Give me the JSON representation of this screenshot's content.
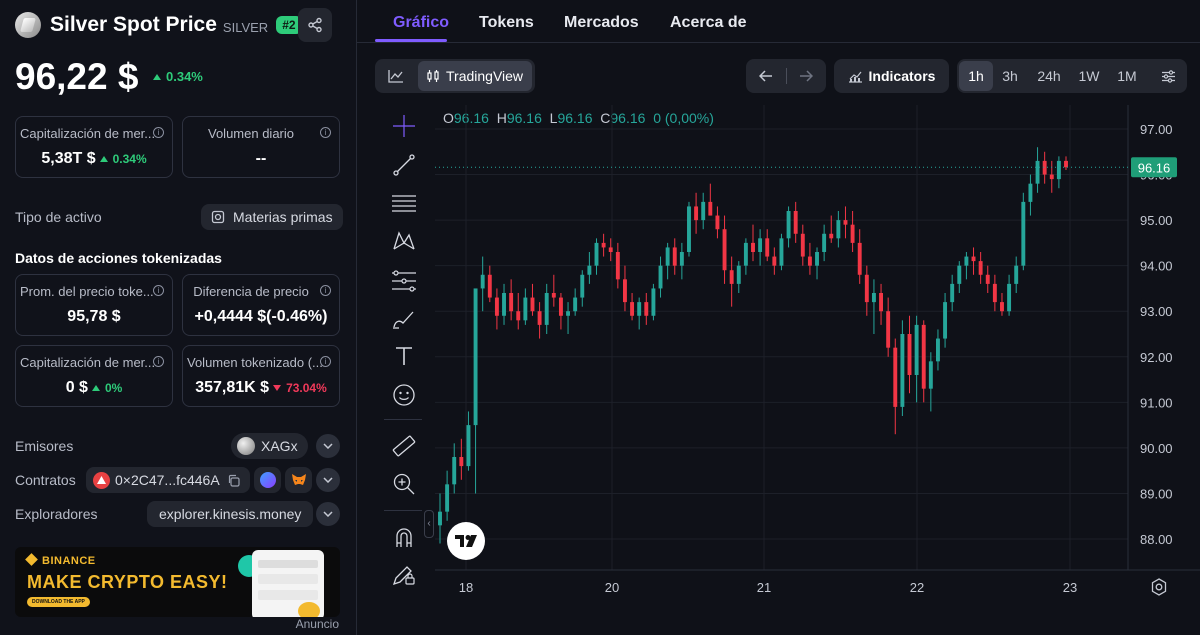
{
  "asset": {
    "name": "Silver Spot Price",
    "symbol": "SILVER",
    "rank": "#2",
    "price": "96,22 $",
    "change": "0.34%"
  },
  "stats": {
    "market_cap": {
      "label": "Capitalización de mer...",
      "value": "5,38T $",
      "change": "0.34%"
    },
    "daily_volume": {
      "label": "Volumen diario",
      "value": "--"
    }
  },
  "asset_type": {
    "label": "Tipo de activo",
    "value": "Materias primas"
  },
  "tokenized": {
    "title": "Datos de acciones tokenizadas",
    "avg_price": {
      "label": "Prom. del precio toke...",
      "value": "95,78 $"
    },
    "price_diff": {
      "label": "Diferencia de precio",
      "value": "+0,4444 $(-0.46%)"
    },
    "tok_market_cap": {
      "label": "Capitalización de mer...",
      "value": "0 $",
      "change": "0%"
    },
    "tok_volume": {
      "label": "Volumen tokenizado (...",
      "value": "357,81K $",
      "change": "73.04%"
    }
  },
  "issuers": {
    "label": "Emisores",
    "value": "XAGx"
  },
  "contracts": {
    "label": "Contratos",
    "value": "0×2C47...fc446A"
  },
  "explorers": {
    "label": "Exploradores",
    "value": "explorer.kinesis.money"
  },
  "banner": {
    "brand": "BINANCE",
    "headline": "MAKE CRYPTO EASY!",
    "cta": "DOWNLOAD THE APP",
    "ad_label": "Anuncio"
  },
  "tabs": [
    {
      "label": "Gráfico",
      "active": true
    },
    {
      "label": "Tokens"
    },
    {
      "label": "Mercados"
    },
    {
      "label": "Acerca de"
    }
  ],
  "toolbar": {
    "tradingview_label": "TradingView",
    "indicators_label": "Indicators",
    "timeframes": [
      "1h",
      "3h",
      "24h",
      "1W",
      "1M"
    ],
    "selected_timeframe": "1h"
  },
  "ohlc": {
    "o": "96.16",
    "h": "96.16",
    "l": "96.16",
    "c": "96.16",
    "chg": "0 (0,00%)"
  },
  "colors": {
    "up": "#26a69a",
    "down": "#f23645",
    "accent": "#7f5cff",
    "green": "#2ecb7a",
    "red": "#f0395a"
  },
  "chart_data": {
    "type": "candlestick",
    "title": "",
    "x_ticks": [
      "18",
      "20",
      "21",
      "22",
      "23"
    ],
    "y_ticks": [
      "97.00",
      "96.00",
      "95.00",
      "94.00",
      "93.00",
      "92.00",
      "91.00",
      "90.00",
      "89.00",
      "88.00"
    ],
    "ylim": [
      87.6,
      97.4
    ],
    "last_price": "96.16",
    "timeframe": "1h",
    "candles": [
      {
        "o": 88.3,
        "h": 89.0,
        "l": 87.9,
        "c": 88.6
      },
      {
        "o": 88.6,
        "h": 89.5,
        "l": 88.4,
        "c": 89.2
      },
      {
        "o": 89.2,
        "h": 90.1,
        "l": 89.0,
        "c": 89.8
      },
      {
        "o": 89.8,
        "h": 90.2,
        "l": 89.3,
        "c": 89.6
      },
      {
        "o": 89.6,
        "h": 90.8,
        "l": 89.5,
        "c": 90.5
      },
      {
        "o": 90.5,
        "h": 93.5,
        "l": 89.0,
        "c": 93.5
      },
      {
        "o": 93.5,
        "h": 94.2,
        "l": 93.0,
        "c": 93.8
      },
      {
        "o": 93.8,
        "h": 94.0,
        "l": 93.2,
        "c": 93.3
      },
      {
        "o": 93.3,
        "h": 93.5,
        "l": 92.6,
        "c": 92.9
      },
      {
        "o": 92.9,
        "h": 93.6,
        "l": 92.7,
        "c": 93.4
      },
      {
        "o": 93.4,
        "h": 93.7,
        "l": 92.8,
        "c": 93.0
      },
      {
        "o": 93.0,
        "h": 93.4,
        "l": 92.6,
        "c": 92.8
      },
      {
        "o": 92.8,
        "h": 93.5,
        "l": 92.7,
        "c": 93.3
      },
      {
        "o": 93.3,
        "h": 93.6,
        "l": 92.9,
        "c": 93.0
      },
      {
        "o": 93.0,
        "h": 93.2,
        "l": 92.4,
        "c": 92.7
      },
      {
        "o": 92.7,
        "h": 93.6,
        "l": 92.5,
        "c": 93.4
      },
      {
        "o": 93.4,
        "h": 93.8,
        "l": 93.1,
        "c": 93.3
      },
      {
        "o": 93.3,
        "h": 93.4,
        "l": 92.6,
        "c": 92.9
      },
      {
        "o": 92.9,
        "h": 93.2,
        "l": 92.5,
        "c": 93.0
      },
      {
        "o": 93.0,
        "h": 93.5,
        "l": 92.9,
        "c": 93.3
      },
      {
        "o": 93.3,
        "h": 93.9,
        "l": 93.1,
        "c": 93.8
      },
      {
        "o": 93.8,
        "h": 94.3,
        "l": 93.6,
        "c": 94.0
      },
      {
        "o": 94.0,
        "h": 94.6,
        "l": 93.8,
        "c": 94.5
      },
      {
        "o": 94.5,
        "h": 94.7,
        "l": 94.2,
        "c": 94.4
      },
      {
        "o": 94.4,
        "h": 94.6,
        "l": 94.1,
        "c": 94.3
      },
      {
        "o": 94.3,
        "h": 94.5,
        "l": 93.5,
        "c": 93.7
      },
      {
        "o": 93.7,
        "h": 94.0,
        "l": 93.0,
        "c": 93.2
      },
      {
        "o": 93.2,
        "h": 93.4,
        "l": 92.8,
        "c": 92.9
      },
      {
        "o": 92.9,
        "h": 93.3,
        "l": 92.6,
        "c": 93.2
      },
      {
        "o": 93.2,
        "h": 93.4,
        "l": 92.7,
        "c": 92.9
      },
      {
        "o": 92.9,
        "h": 93.6,
        "l": 92.8,
        "c": 93.5
      },
      {
        "o": 93.5,
        "h": 94.2,
        "l": 93.3,
        "c": 94.0
      },
      {
        "o": 94.0,
        "h": 94.5,
        "l": 93.7,
        "c": 94.4
      },
      {
        "o": 94.4,
        "h": 94.6,
        "l": 93.8,
        "c": 94.0
      },
      {
        "o": 94.0,
        "h": 94.5,
        "l": 93.7,
        "c": 94.3
      },
      {
        "o": 94.3,
        "h": 95.4,
        "l": 94.2,
        "c": 95.3
      },
      {
        "o": 95.3,
        "h": 95.6,
        "l": 94.7,
        "c": 95.0
      },
      {
        "o": 95.0,
        "h": 95.6,
        "l": 94.8,
        "c": 95.4
      },
      {
        "o": 95.4,
        "h": 95.8,
        "l": 95.1,
        "c": 95.1
      },
      {
        "o": 95.1,
        "h": 95.3,
        "l": 94.6,
        "c": 94.8
      },
      {
        "o": 94.8,
        "h": 95.1,
        "l": 93.6,
        "c": 93.9
      },
      {
        "o": 93.9,
        "h": 94.2,
        "l": 93.1,
        "c": 93.6
      },
      {
        "o": 93.6,
        "h": 94.1,
        "l": 93.4,
        "c": 94.0
      },
      {
        "o": 94.0,
        "h": 94.6,
        "l": 93.8,
        "c": 94.5
      },
      {
        "o": 94.5,
        "h": 94.9,
        "l": 94.1,
        "c": 94.3
      },
      {
        "o": 94.3,
        "h": 94.8,
        "l": 94.0,
        "c": 94.6
      },
      {
        "o": 94.6,
        "h": 94.8,
        "l": 94.1,
        "c": 94.2
      },
      {
        "o": 94.2,
        "h": 94.4,
        "l": 93.8,
        "c": 94.0
      },
      {
        "o": 94.0,
        "h": 94.7,
        "l": 93.9,
        "c": 94.6
      },
      {
        "o": 94.6,
        "h": 95.3,
        "l": 94.4,
        "c": 95.2
      },
      {
        "o": 95.2,
        "h": 95.4,
        "l": 94.5,
        "c": 94.7
      },
      {
        "o": 94.7,
        "h": 94.9,
        "l": 94.0,
        "c": 94.2
      },
      {
        "o": 94.2,
        "h": 94.5,
        "l": 93.8,
        "c": 94.0
      },
      {
        "o": 94.0,
        "h": 94.4,
        "l": 93.7,
        "c": 94.3
      },
      {
        "o": 94.3,
        "h": 94.9,
        "l": 94.1,
        "c": 94.7
      },
      {
        "o": 94.7,
        "h": 95.1,
        "l": 94.5,
        "c": 94.6
      },
      {
        "o": 94.6,
        "h": 95.2,
        "l": 94.4,
        "c": 95.0
      },
      {
        "o": 95.0,
        "h": 95.3,
        "l": 94.6,
        "c": 94.9
      },
      {
        "o": 94.9,
        "h": 95.2,
        "l": 94.3,
        "c": 94.5
      },
      {
        "o": 94.5,
        "h": 94.8,
        "l": 93.6,
        "c": 93.8
      },
      {
        "o": 93.8,
        "h": 94.0,
        "l": 92.9,
        "c": 93.2
      },
      {
        "o": 93.2,
        "h": 93.7,
        "l": 92.5,
        "c": 93.4
      },
      {
        "o": 93.4,
        "h": 93.6,
        "l": 92.7,
        "c": 93.0
      },
      {
        "o": 93.0,
        "h": 93.3,
        "l": 92.0,
        "c": 92.2
      },
      {
        "o": 92.2,
        "h": 92.4,
        "l": 90.3,
        "c": 90.9
      },
      {
        "o": 90.9,
        "h": 92.8,
        "l": 90.7,
        "c": 92.5
      },
      {
        "o": 92.5,
        "h": 92.9,
        "l": 91.2,
        "c": 91.6
      },
      {
        "o": 91.6,
        "h": 92.9,
        "l": 91.0,
        "c": 92.7
      },
      {
        "o": 92.7,
        "h": 92.8,
        "l": 91.0,
        "c": 91.3
      },
      {
        "o": 91.3,
        "h": 92.1,
        "l": 90.8,
        "c": 91.9
      },
      {
        "o": 91.9,
        "h": 92.6,
        "l": 91.7,
        "c": 92.4
      },
      {
        "o": 92.4,
        "h": 93.4,
        "l": 92.2,
        "c": 93.2
      },
      {
        "o": 93.2,
        "h": 93.8,
        "l": 93.0,
        "c": 93.6
      },
      {
        "o": 93.6,
        "h": 94.1,
        "l": 93.4,
        "c": 94.0
      },
      {
        "o": 94.0,
        "h": 94.3,
        "l": 93.7,
        "c": 94.2
      },
      {
        "o": 94.2,
        "h": 94.4,
        "l": 93.8,
        "c": 94.1
      },
      {
        "o": 94.1,
        "h": 94.3,
        "l": 93.6,
        "c": 93.8
      },
      {
        "o": 93.8,
        "h": 94.0,
        "l": 93.4,
        "c": 93.6
      },
      {
        "o": 93.6,
        "h": 93.8,
        "l": 93.0,
        "c": 93.2
      },
      {
        "o": 93.2,
        "h": 93.4,
        "l": 92.9,
        "c": 93.0
      },
      {
        "o": 93.0,
        "h": 93.8,
        "l": 92.9,
        "c": 93.6
      },
      {
        "o": 93.6,
        "h": 94.2,
        "l": 93.4,
        "c": 94.0
      },
      {
        "o": 94.0,
        "h": 95.6,
        "l": 93.9,
        "c": 95.4
      },
      {
        "o": 95.4,
        "h": 96.0,
        "l": 95.1,
        "c": 95.8
      },
      {
        "o": 95.8,
        "h": 96.6,
        "l": 95.6,
        "c": 96.3
      },
      {
        "o": 96.3,
        "h": 96.5,
        "l": 95.8,
        "c": 96.0
      },
      {
        "o": 96.0,
        "h": 96.3,
        "l": 95.6,
        "c": 95.9
      },
      {
        "o": 95.9,
        "h": 96.4,
        "l": 95.7,
        "c": 96.3
      },
      {
        "o": 96.3,
        "h": 96.4,
        "l": 96.1,
        "c": 96.16
      }
    ]
  }
}
